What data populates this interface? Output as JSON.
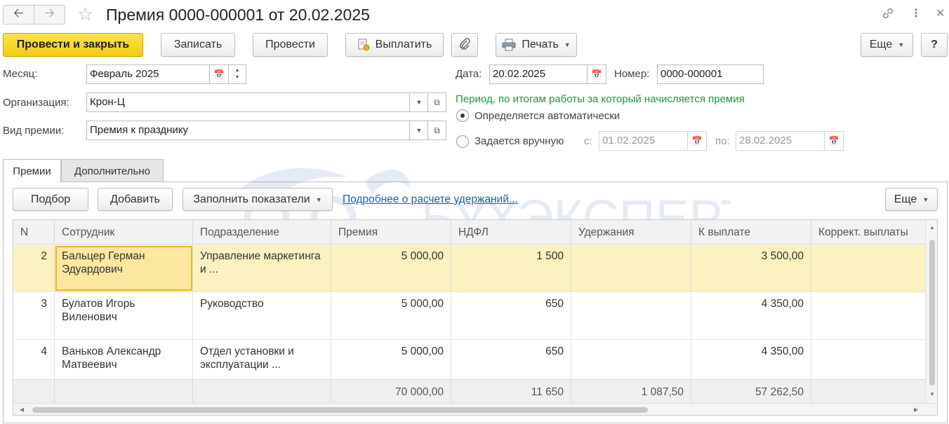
{
  "window": {
    "title": "Премия 0000-000001 от 20.02.2025"
  },
  "toolbar": {
    "post_close": "Провести и закрыть",
    "save": "Записать",
    "post": "Провести",
    "pay": "Выплатить",
    "print": "Печать",
    "more": "Еще",
    "help": "?"
  },
  "form": {
    "month_label": "Месяц:",
    "month_value": "Февраль 2025",
    "org_label": "Организация:",
    "org_value": "Крон-Ц",
    "bonus_type_label": "Вид премии:",
    "bonus_type_value": "Премия к празднику",
    "date_label": "Дата:",
    "date_value": "20.02.2025",
    "number_label": "Номер:",
    "number_value": "0000-000001",
    "period_heading": "Период, по итогам работы за который начисляется премия",
    "radio_auto": "Определяется автоматически",
    "radio_manual": "Задается вручную",
    "from_label": "с:",
    "from_value": "01.02.2025",
    "to_label": "по:",
    "to_value": "28.02.2025"
  },
  "tabs": [
    {
      "label": "Премии",
      "active": true
    },
    {
      "label": "Дополнительно",
      "active": false
    }
  ],
  "table_toolbar": {
    "pick": "Подбор",
    "add": "Добавить",
    "fill": "Заполнить показатели",
    "link": "Подробнее о расчете удержаний...",
    "more": "Еще"
  },
  "table": {
    "columns": [
      "N",
      "Сотрудник",
      "Подразделение",
      "Премия",
      "НДФЛ",
      "Удержания",
      "К выплате",
      "Коррект. выплаты"
    ],
    "rows": [
      {
        "n": "2",
        "employee": "Бальцер Герман Эдуардович",
        "dept": "Управление маркетинга и ...",
        "bonus": "5 000,00",
        "ndfl": "1 500",
        "deductions": "",
        "payout": "3 500,00",
        "correction": ""
      },
      {
        "n": "3",
        "employee": "Булатов Игорь Виленович",
        "dept": "Руководство",
        "bonus": "5 000,00",
        "ndfl": "650",
        "deductions": "",
        "payout": "4 350,00",
        "correction": ""
      },
      {
        "n": "4",
        "employee": "Ваньков Александр Матвеевич",
        "dept": "Отдел установки и эксплуатации ...",
        "bonus": "5 000,00",
        "ndfl": "650",
        "deductions": "",
        "payout": "4 350,00",
        "correction": ""
      }
    ],
    "totals": {
      "bonus": "70 000,00",
      "ndfl": "11 650",
      "deductions": "1 087,50",
      "payout": "57 262,50"
    }
  },
  "watermark": "БУХЭКСПЕРТ",
  "colors": {
    "primary_button": "#f3cd10",
    "selected_row": "#fbf1c1",
    "heading_green": "#1a9a3a",
    "link": "#1f5db8"
  },
  "icons": [
    "back-arrow-icon",
    "forward-arrow-icon",
    "star-icon",
    "link-icon",
    "kebab-menu-icon",
    "close-icon",
    "payment-icon",
    "paperclip-icon",
    "printer-icon",
    "calendar-icon",
    "open-icon",
    "dropdown-icon"
  ]
}
